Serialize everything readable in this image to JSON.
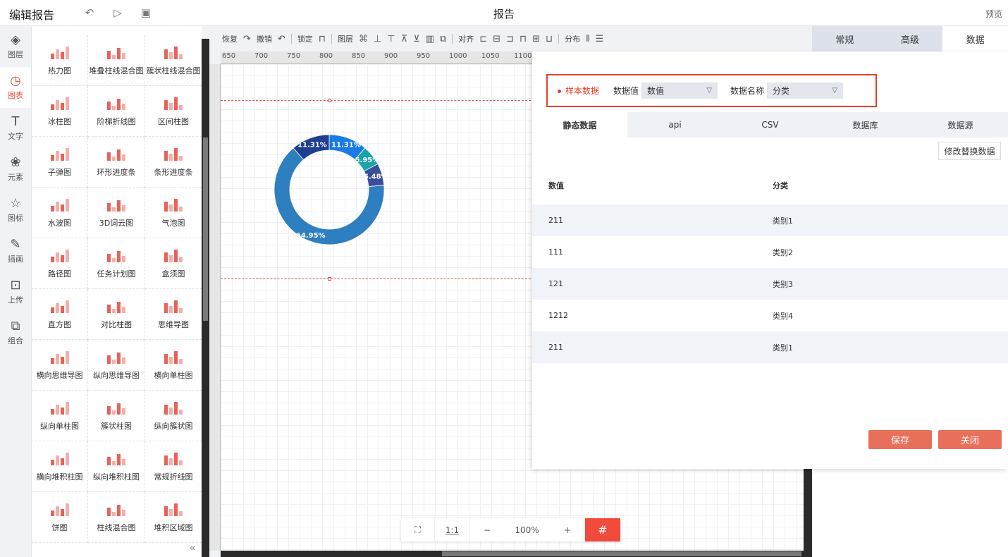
{
  "header": {
    "title": "编辑报告",
    "report_name": "报告",
    "preview": "预览"
  },
  "leftnav": [
    {
      "label": "图层",
      "icon": "layers-icon",
      "glyph": "◈"
    },
    {
      "label": "图表",
      "icon": "chart-icon",
      "glyph": "◷"
    },
    {
      "label": "文字",
      "icon": "text-icon",
      "glyph": "T"
    },
    {
      "label": "元素",
      "icon": "elements-icon",
      "glyph": "❀"
    },
    {
      "label": "图标",
      "icon": "star-icon",
      "glyph": "☆"
    },
    {
      "label": "插画",
      "icon": "palette-icon",
      "glyph": "✎"
    },
    {
      "label": "上传",
      "icon": "upload-icon",
      "glyph": "⊡"
    },
    {
      "label": "组合",
      "icon": "group-icon",
      "glyph": "⧉"
    }
  ],
  "palette": [
    "热力图",
    "堆叠柱线混合图",
    "簇状柱线混合图",
    "冰柱图",
    "阶梯折线图",
    "区间柱图",
    "子弹图",
    "环形进度条",
    "条形进度条",
    "水波图",
    "3D词云图",
    "气泡图",
    "路径图",
    "任务计划图",
    "盒须图",
    "直方图",
    "对比柱图",
    "思维导图",
    "横向思维导图",
    "纵向思维导图",
    "横向单柱图",
    "纵向单柱图",
    "簇状柱图",
    "纵向簇状图",
    "横向堆积柱图",
    "纵向堆积柱图",
    "常规折线图",
    "饼图",
    "柱线混合图",
    "堆积区域图"
  ],
  "toolbar": {
    "restore": "恢复",
    "undo": "撤销",
    "lock": "锁定",
    "layer": "图层",
    "align": "对齐",
    "distribute": "分布"
  },
  "ruler_ticks": [
    "650",
    "700",
    "750",
    "800",
    "850",
    "900",
    "950",
    "1000",
    "1050",
    "1100"
  ],
  "zoom": {
    "fit": "⛶",
    "ratio": "1:1",
    "minus": "−",
    "level": "100%",
    "plus": "+",
    "grid": "#"
  },
  "rpanel_tabs": [
    "常规",
    "高级",
    "数据"
  ],
  "data_panel": {
    "sample": "样本数据",
    "value_label": "数据值",
    "value_select": "数值",
    "name_label": "数据名称",
    "name_select": "分类",
    "tabs": [
      "静态数据",
      "api",
      "CSV",
      "数据库",
      "数据源"
    ],
    "modify": "修改替换数据",
    "columns": [
      "数值",
      "分类"
    ],
    "rows": [
      [
        "211",
        "类别1"
      ],
      [
        "111",
        "类别2"
      ],
      [
        "121",
        "类别3"
      ],
      [
        "1212",
        "类别4"
      ],
      [
        "211",
        "类别1"
      ]
    ],
    "save": "保存",
    "close": "关闭"
  },
  "chart_data": {
    "type": "pie",
    "variant": "donut",
    "categories": [
      "类别1",
      "类别2",
      "类别3",
      "类别4",
      "类别1"
    ],
    "values": [
      211,
      111,
      121,
      1212,
      211
    ],
    "labels": [
      "11.31%",
      "5.95%",
      "6.48%",
      "64.95%",
      "11.31%"
    ],
    "colors": [
      "#1a7be6",
      "#1aa3a8",
      "#3a4e9c",
      "#2e7fc0",
      "#1e3f8f"
    ]
  }
}
